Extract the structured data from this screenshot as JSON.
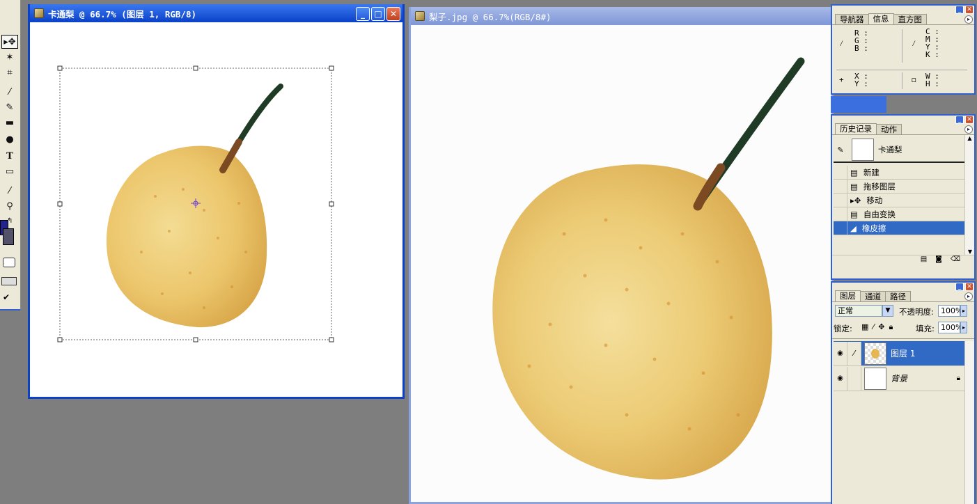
{
  "toolbox": {
    "tools": [
      "move-tool",
      "magic-wand-tool",
      "crop-tool",
      "brush-tool",
      "history-brush-tool",
      "gradient-tool",
      "dodge-tool",
      "type-tool",
      "rectangle-tool",
      "eyedropper-tool",
      "zoom-tool"
    ],
    "type_glyph": "T"
  },
  "doc1": {
    "title": "卡通梨 @ 66.7% (图层 1, RGB/8)",
    "min_glyph": "_",
    "max_glyph": "□",
    "close_glyph": "✕"
  },
  "doc2": {
    "title": "梨子.jpg @ 66.7%(RGB/8#)"
  },
  "navigator_panel": {
    "tabs": [
      "导航器",
      "信息",
      "直方图"
    ],
    "active_tab": "信息",
    "rgb_labels": [
      "R :",
      "G :",
      "B :"
    ],
    "cmyk_labels": [
      "C :",
      "M :",
      "Y :",
      "K :"
    ],
    "xy_labels": [
      "X :",
      "Y :"
    ],
    "wh_labels": [
      "W :",
      "H :"
    ]
  },
  "history_panel": {
    "tabs": [
      "历史记录",
      "动作"
    ],
    "active_tab": "历史记录",
    "snapshot_label": "卡通梨",
    "items": [
      "新建",
      "拖移图层",
      "移动",
      "自由变换",
      "橡皮擦"
    ],
    "selected_item": "橡皮擦"
  },
  "layers_panel": {
    "tabs": [
      "图层",
      "通道",
      "路径"
    ],
    "active_tab": "图层",
    "blend_mode": "正常",
    "opacity_label": "不透明度:",
    "opacity_value": "100%",
    "lock_label": "锁定:",
    "fill_label": "填充:",
    "fill_value": "100%",
    "layers": [
      "图层 1",
      "背景"
    ],
    "selected_layer": "图层 1"
  },
  "colors": {
    "titlebar_active": "#0a41c8",
    "titlebar_inactive": "#8aa3df",
    "selection_blue": "#316ac5",
    "panel_bg": "#ece9d8",
    "workspace_gray": "#7e7e7e"
  }
}
